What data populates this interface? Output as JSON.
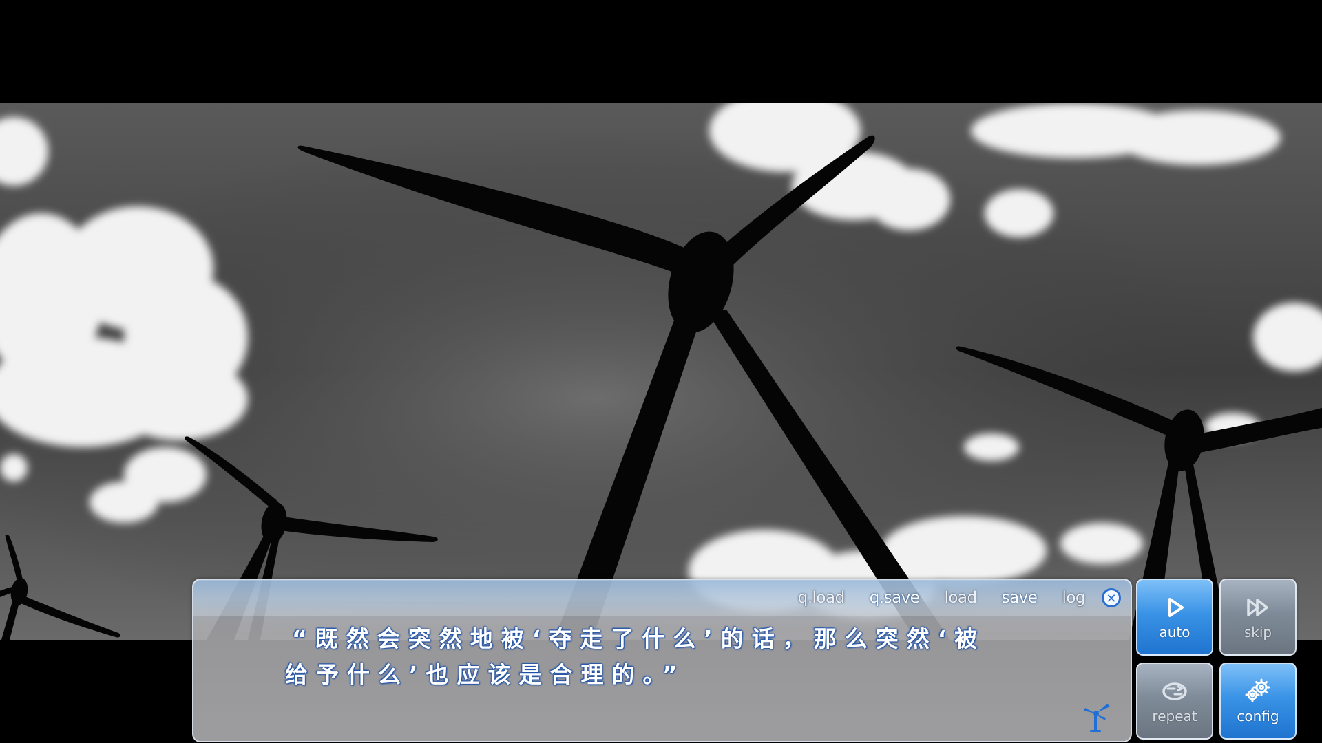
{
  "menu": {
    "items": [
      {
        "label": "q.load"
      },
      {
        "label": "q.save"
      },
      {
        "label": "load"
      },
      {
        "label": "save"
      },
      {
        "label": "log"
      }
    ],
    "close_symbol": "✕"
  },
  "dialogue": {
    "line1": "“既然会突然地被‘夺走了什么’的话，那么突然‘被",
    "line2": "给予什么’也应该是合理的。”"
  },
  "side_buttons": {
    "auto": {
      "label": "auto",
      "icon": "play-icon"
    },
    "skip": {
      "label": "skip",
      "icon": "fast-forward-icon"
    },
    "repeat": {
      "label": "repeat",
      "icon": "repeat-icon"
    },
    "config": {
      "label": "config",
      "icon": "gear-icon"
    }
  },
  "colors": {
    "accent": "#2a6fd0",
    "button_active": "#3a93e6",
    "button_inactive": "#7f8b98",
    "text_outline": "#1b4fa8"
  }
}
